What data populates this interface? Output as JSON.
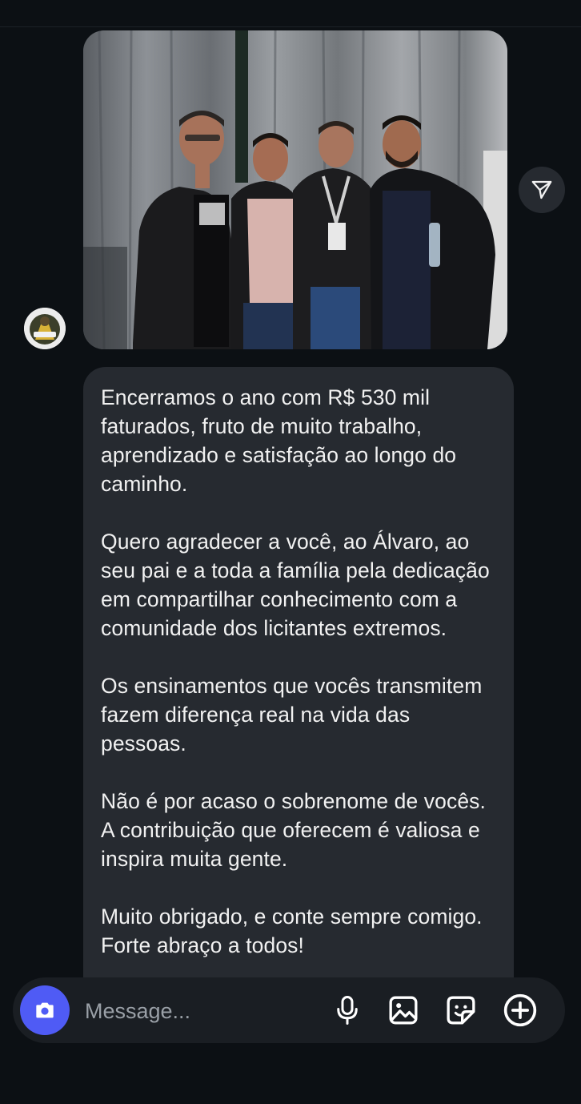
{
  "conversation": {
    "photo": {
      "alt": "Four men posing together at an event"
    },
    "message": {
      "paragraphs": [
        "Encerramos o ano com R$ 530 mil faturados, fruto de muito trabalho, aprendizado e satisfação ao longo do caminho.",
        "Quero agradecer a você, ao Álvaro, ao seu pai e a toda a família pela dedicação em compartilhar conhecimento com a comunidade dos licitantes extremos.",
        "Os ensinamentos que vocês transmitem fazem diferença real na vida das pessoas.",
        "Não é por acaso o sobrenome de vocês. A contribuição que oferecem é valiosa e inspira muita gente.",
        "Muito obrigado, e conte sempre comigo. Forte abraço a todos!"
      ]
    }
  },
  "composer": {
    "placeholder": "Message..."
  },
  "icons": {
    "share": "paper-plane-icon",
    "camera": "camera-icon",
    "mic": "microphone-icon",
    "gallery": "image-icon",
    "sticker": "sticker-icon",
    "more": "plus-icon"
  },
  "colors": {
    "background": "#0c1014",
    "bubble": "#262a30",
    "accent": "#4f5bf5",
    "text": "#f1f1f1"
  }
}
